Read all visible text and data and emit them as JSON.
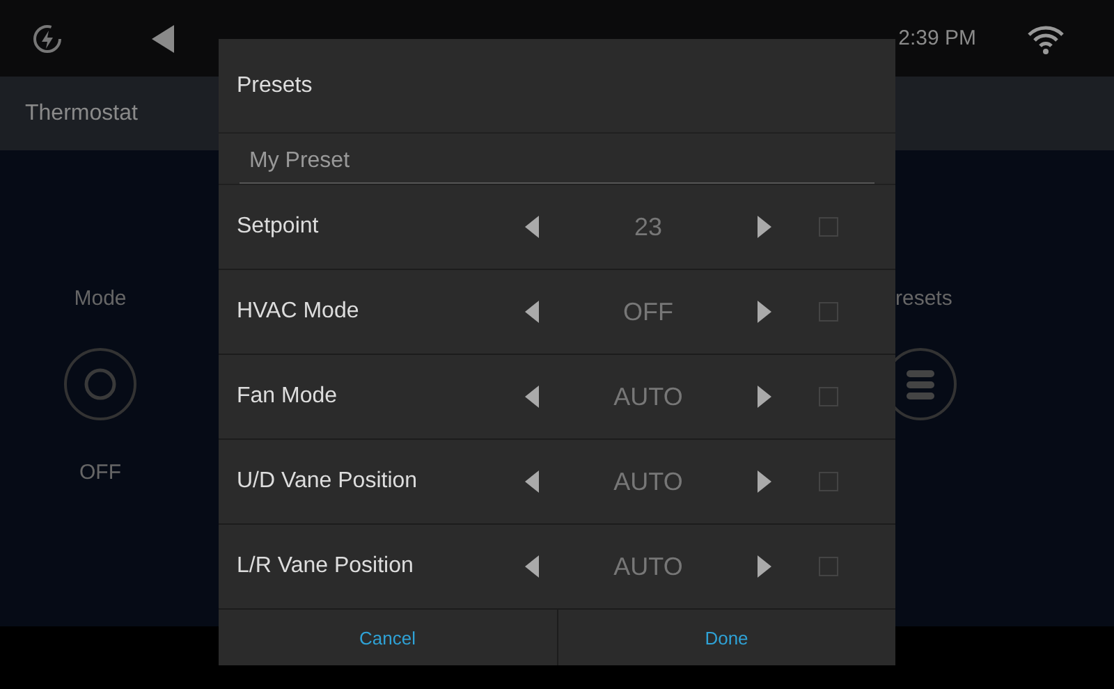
{
  "top_bar": {
    "time": "2:39 PM"
  },
  "header": {
    "title": "Thermostat"
  },
  "background_controls": [
    {
      "kind": "mode",
      "label": "Mode",
      "value": "OFF"
    },
    {
      "kind": "presets",
      "label": "resets"
    }
  ],
  "dialog": {
    "title": "Presets",
    "name_field": {
      "value": "My Preset"
    },
    "rows": [
      {
        "label": "Setpoint",
        "value": "23",
        "checked": false
      },
      {
        "label": "HVAC Mode",
        "value": "OFF",
        "checked": false
      },
      {
        "label": "Fan Mode",
        "value": "AUTO",
        "checked": false
      },
      {
        "label": "U/D Vane Position",
        "value": "AUTO",
        "checked": false
      },
      {
        "label": "L/R Vane Position",
        "value": "AUTO",
        "checked": false
      }
    ],
    "buttons": [
      "Cancel",
      "Done"
    ]
  }
}
